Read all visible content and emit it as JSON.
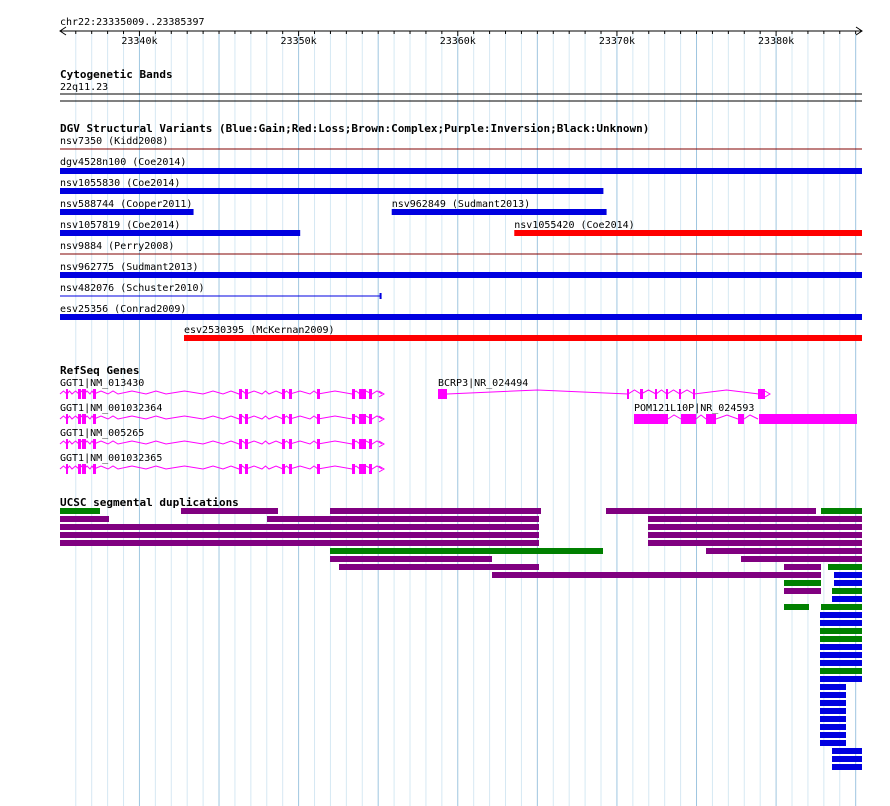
{
  "region": "chr22:23335009..23385397",
  "region_start": 23335009,
  "region_end": 23385397,
  "ruler": {
    "ticks": [
      {
        "pos": 23340000,
        "label": "23340k"
      },
      {
        "pos": 23350000,
        "label": "23350k"
      },
      {
        "pos": 23360000,
        "label": "23360k"
      },
      {
        "pos": 23370000,
        "label": "23370k"
      },
      {
        "pos": 23380000,
        "label": "23380k"
      }
    ]
  },
  "colors": {
    "grid_major": "#9fc6e0",
    "grid_minor": "#d6e8f3",
    "gain": "#0000e0",
    "loss": "#ff0000",
    "gene": "#ff00ff",
    "seg_green": "#008000",
    "seg_purple": "#800080",
    "seg_blue": "#0000e0",
    "line": "#800000"
  },
  "tracks": {
    "cytoband": {
      "title": "Cytogenetic Bands",
      "band": "22q11.23"
    },
    "dgv": {
      "title": "DGV Structural Variants (Blue:Gain;Red:Loss;Brown:Complex;Purple:Inversion;Black:Unknown)",
      "features": [
        {
          "label": "nsv7350 (Kidd2008)",
          "start": 23335009,
          "end": 23385397,
          "type": "complex"
        },
        {
          "label": "dgv4528n100 (Coe2014)",
          "start": 23335009,
          "end": 23385397,
          "type": "gain"
        },
        {
          "label": "nsv1055830 (Coe2014)",
          "start": 23335009,
          "end": 23369150,
          "type": "gain"
        },
        {
          "label": "nsv588744 (Cooper2011)",
          "start": 23335009,
          "end": 23343400,
          "type": "gain"
        },
        {
          "label": "nsv962849 (Sudmant2013)",
          "start": 23355850,
          "end": 23369350,
          "type": "gain"
        },
        {
          "label": "nsv1057819 (Coe2014)",
          "start": 23335009,
          "end": 23350100,
          "type": "gain"
        },
        {
          "label": "nsv1055420 (Coe2014)",
          "start": 23363550,
          "end": 23385397,
          "type": "loss"
        },
        {
          "label": "nsv9884 (Perry2008)",
          "start": 23335009,
          "end": 23385397,
          "type": "complex"
        },
        {
          "label": "nsv962775 (Sudmant2013)",
          "start": 23335009,
          "end": 23385397,
          "type": "gain"
        },
        {
          "label": "nsv482076 (Schuster2010)",
          "start": 23335009,
          "end": 23355150,
          "type": "gain_thin"
        },
        {
          "label": "esv25356 (Conrad2009)",
          "start": 23335009,
          "end": 23385397,
          "type": "gain"
        },
        {
          "label": "esv2530395 (McKernan2009)",
          "start": 23342800,
          "end": 23385397,
          "type": "loss"
        }
      ]
    },
    "refseq": {
      "title": "RefSeq Genes",
      "genes": [
        {
          "label": "GGT1|NM_013430"
        },
        {
          "label": "GGT1|NM_001032364"
        },
        {
          "label": "GGT1|NM_005265"
        },
        {
          "label": "GGT1|NM_001032365"
        },
        {
          "label": "BCRP3|NR_024494"
        },
        {
          "label": "POM121L10P|NR_024593"
        }
      ]
    },
    "segdups": {
      "title": "UCSC segmental duplications"
    }
  }
}
